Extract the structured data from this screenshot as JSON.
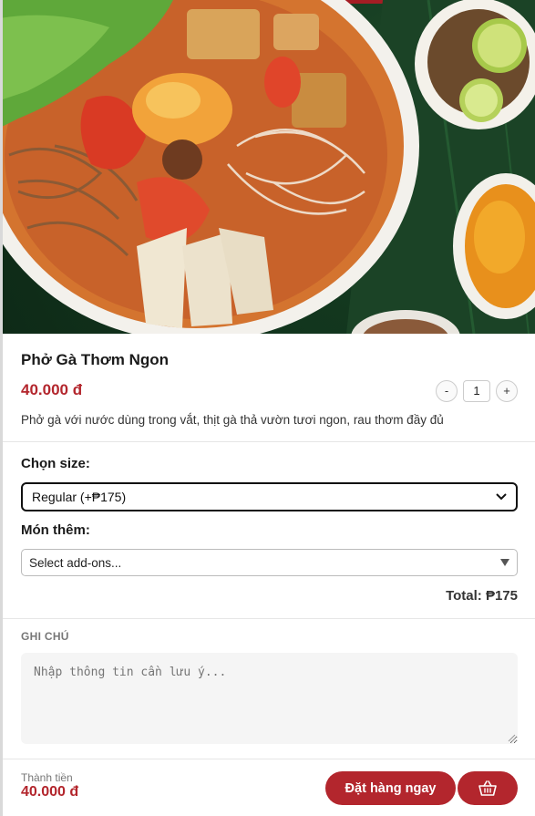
{
  "product": {
    "name": "Phở Gà Thơm Ngon",
    "price": "40.000 đ",
    "description": "Phở gà với nước dùng trong vắt, thịt gà thả vườn tươi ngon, rau thơm đầy đủ",
    "image_icon": "pho-bowl-image"
  },
  "quantity": {
    "decrease_label": "-",
    "value": "1",
    "increase_label": "+"
  },
  "size": {
    "label": "Chọn size:",
    "selected": "Regular (+₱175)"
  },
  "addons": {
    "label": "Món thêm:",
    "placeholder": "Select add-ons..."
  },
  "total": "Total: ₱175",
  "note": {
    "label": "GHI CHÚ",
    "placeholder": "Nhập thông tin cần lưu ý..."
  },
  "footer": {
    "subtotal_label": "Thành tiền",
    "subtotal_value": "40.000 đ",
    "order_button": "Đặt hàng ngay",
    "cart_icon": "basket-icon"
  },
  "colors": {
    "accent": "#b3262d",
    "divider": "#e6e6e6"
  }
}
